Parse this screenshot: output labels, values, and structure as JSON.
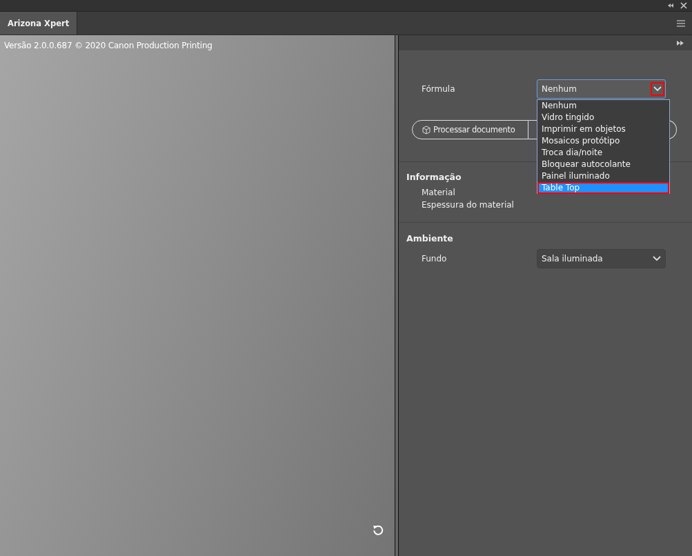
{
  "tab": {
    "label": "Arizona Xpert",
    "selected": true
  },
  "viewport": {
    "version": "Versão 2.0.0.687 © 2020 Canon Production Printing"
  },
  "formula": {
    "label": "Fórmula",
    "value": "Nenhum",
    "expanded": true,
    "options": [
      {
        "label": "Nenhum",
        "highlighted": false
      },
      {
        "label": "Vidro tingido",
        "highlighted": false
      },
      {
        "label": "Imprimir em objetos",
        "highlighted": false
      },
      {
        "label": "Mosaicos protótipo",
        "highlighted": false
      },
      {
        "label": "Troca dia/noite",
        "highlighted": false
      },
      {
        "label": "Bloquear autocolante",
        "highlighted": false
      },
      {
        "label": "Painel iluminado",
        "highlighted": false
      },
      {
        "label": "Table Top",
        "highlighted": true
      }
    ]
  },
  "process_button": {
    "label": "Processar documento"
  },
  "info": {
    "title": "Informação",
    "items": [
      "Material",
      "Espessura do material"
    ]
  },
  "environment": {
    "title": "Ambiente",
    "fields": [
      {
        "label": "Fundo",
        "value": "Sala iluminada"
      }
    ]
  }
}
